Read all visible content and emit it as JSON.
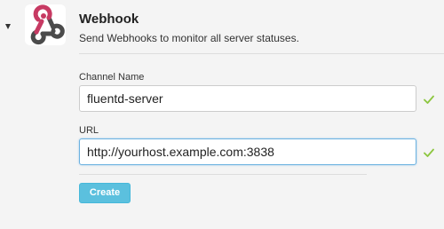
{
  "integration": {
    "title": "Webhook",
    "description": "Send Webhooks to monitor all server statuses.",
    "logo_icon": "webhook-logo-icon",
    "collapse_icon": "caret-down-icon"
  },
  "form": {
    "channel_name": {
      "label": "Channel Name",
      "value": "fluentd-server",
      "valid_icon": "check-icon"
    },
    "url": {
      "label": "URL",
      "value": "http://yourhost.example.com:3838",
      "valid_icon": "check-icon"
    },
    "create_label": "Create"
  },
  "colors": {
    "button": "#5bc0de",
    "check": "#8cc63f",
    "logo_pink": "#c73a63",
    "logo_dark": "#4b4b4b"
  }
}
